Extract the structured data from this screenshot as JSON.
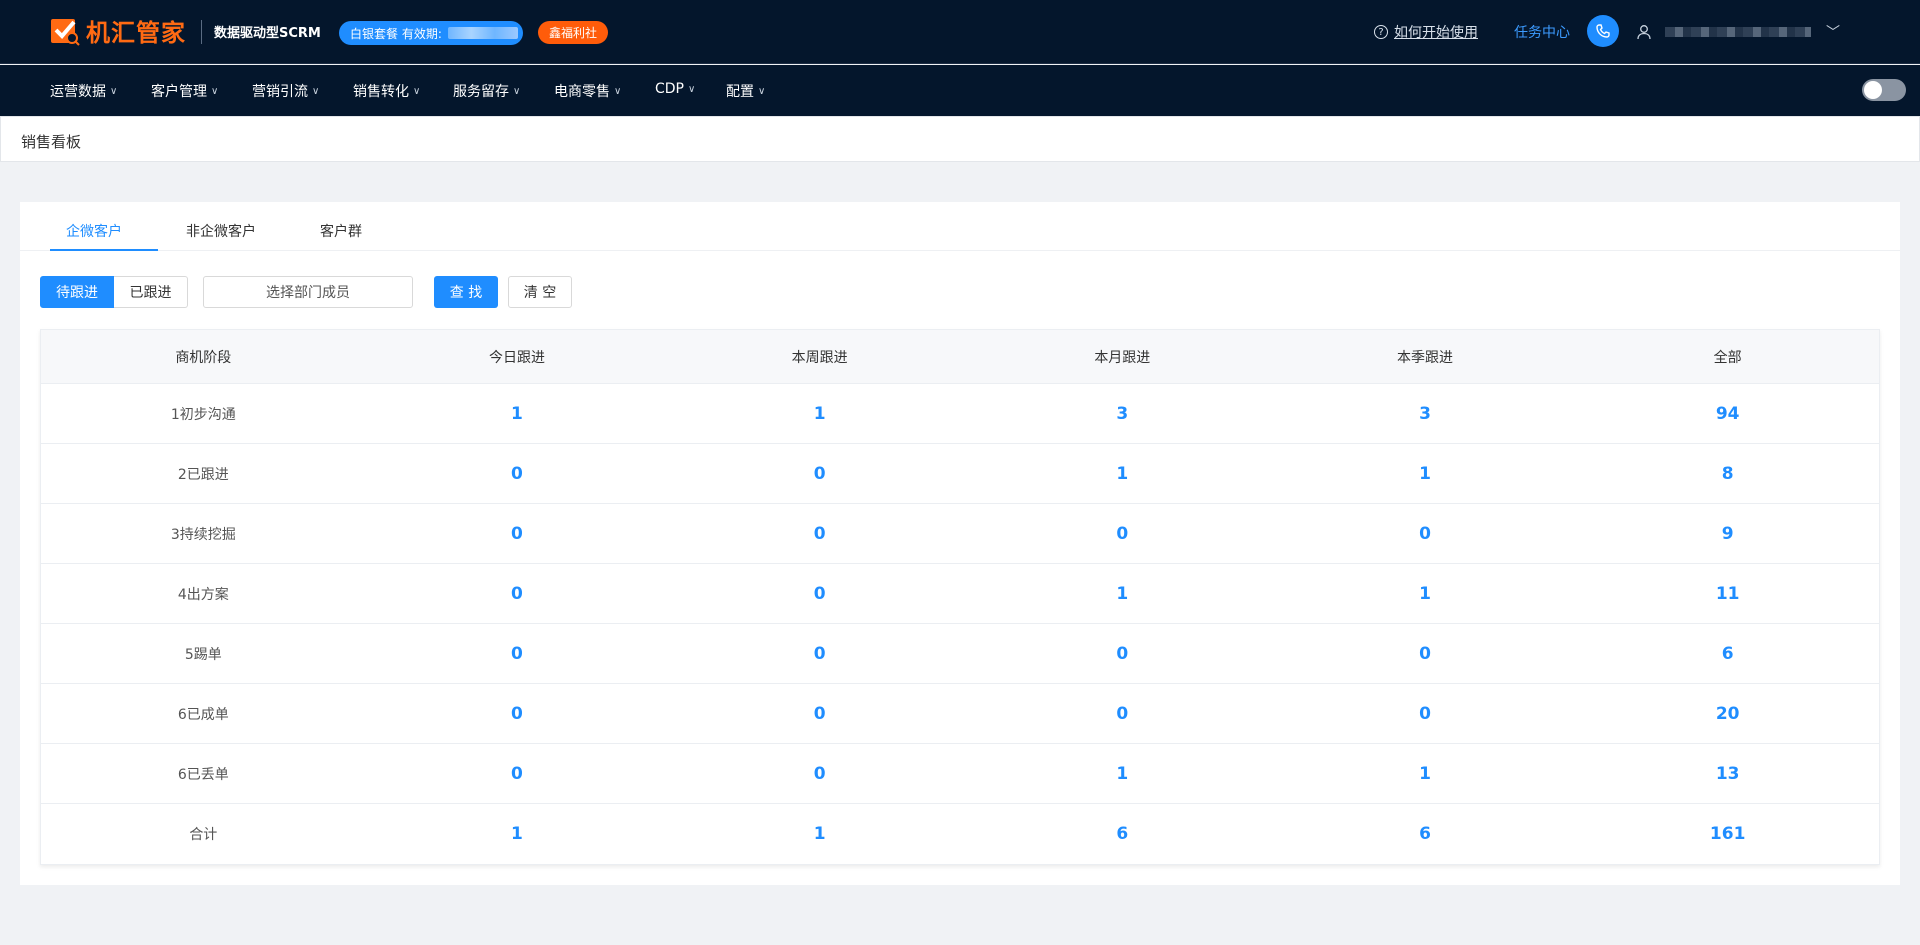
{
  "header": {
    "logo_text": "机汇管家",
    "subtitle": "数据驱动型SCRM",
    "plan_label": "白银套餐 有效期:",
    "welfare_label": "鑫福利社",
    "help_label": "如何开始使用",
    "task_center_label": "任务中心"
  },
  "nav": {
    "items": [
      "运营数据",
      "客户管理",
      "营销引流",
      "销售转化",
      "服务留存",
      "电商零售",
      "CDP",
      "配置"
    ]
  },
  "breadcrumb": {
    "title": "销售看板"
  },
  "tabs": [
    "企微客户",
    "非企微客户",
    "客户群"
  ],
  "filters": {
    "pending_label": "待跟进",
    "done_label": "已跟进",
    "dept_placeholder": "选择部门成员",
    "search_label": "查 找",
    "clear_label": "清 空"
  },
  "table": {
    "headers": [
      "商机阶段",
      "今日跟进",
      "本周跟进",
      "本月跟进",
      "本季跟进",
      "全部"
    ],
    "rows": [
      {
        "stage": "1初步沟通",
        "values": [
          "1",
          "1",
          "3",
          "3",
          "94"
        ]
      },
      {
        "stage": "2已跟进",
        "values": [
          "0",
          "0",
          "1",
          "1",
          "8"
        ]
      },
      {
        "stage": "3持续挖掘",
        "values": [
          "0",
          "0",
          "0",
          "0",
          "9"
        ]
      },
      {
        "stage": "4出方案",
        "values": [
          "0",
          "0",
          "1",
          "1",
          "11"
        ]
      },
      {
        "stage": "5踢单",
        "values": [
          "0",
          "0",
          "0",
          "0",
          "6"
        ]
      },
      {
        "stage": "6已成单",
        "values": [
          "0",
          "0",
          "0",
          "0",
          "20"
        ]
      },
      {
        "stage": "6已丢单",
        "values": [
          "0",
          "0",
          "1",
          "1",
          "13"
        ]
      },
      {
        "stage": "合计",
        "values": [
          "1",
          "1",
          "6",
          "6",
          "161"
        ]
      }
    ]
  },
  "colors": {
    "accent": "#1f8dff",
    "brand": "#ff6a13",
    "header_bg": "#04162c",
    "welfare": "#ff5c0a"
  }
}
